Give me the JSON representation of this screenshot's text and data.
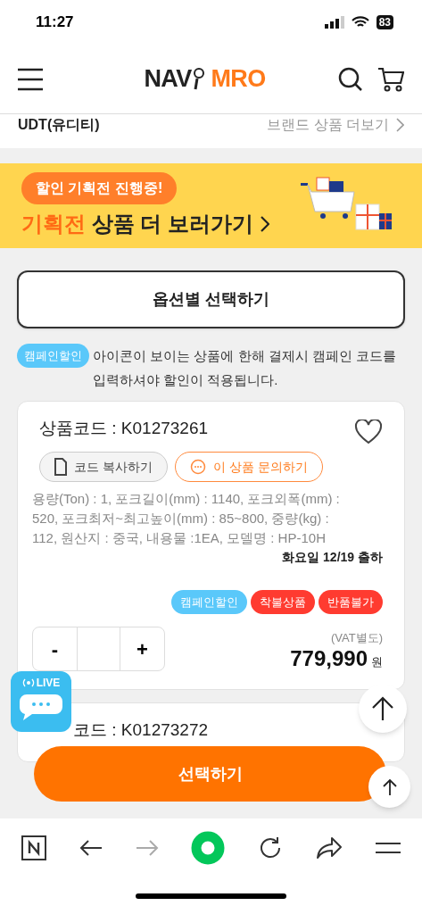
{
  "status_bar": {
    "time": "11:27",
    "battery": "83"
  },
  "header": {
    "logo_left": "NAV",
    "logo_right": "MRO"
  },
  "brand_bar": {
    "brand": "UDT(유디티)",
    "link": "브랜드 상품 더보기"
  },
  "banner": {
    "badge": "할인 기획전 진행중!",
    "highlight": "기획전",
    "title": "상품 더 보러가기"
  },
  "option_button": "옵션별 선택하기",
  "notice": {
    "tag": "캠페인할인",
    "text": "아이콘이 보이는 상품에 한해 결제시 캠페인 코드를 입력하셔야 할인이 적용됩니다."
  },
  "products": [
    {
      "code": "상품코드 : K01273261",
      "favorite": false,
      "copy_button": "코드 복사하기",
      "inquiry_button": "이 상품 문의하기",
      "specs": "용량(Ton) : 1, 포크길이(mm) : 1140, 포크외폭(mm) : 520, 포크최저~최고높이(mm) : 85~800, 중량(kg) : 112, 원산지 : 중국, 내용물 :1EA, 모델명 : HP-10H",
      "shipping": "화요일 12/19 출하",
      "tags": [
        {
          "label": "캠페인할인",
          "color": "#5ac8fa"
        },
        {
          "label": "착불상품",
          "color": "#ff3b30"
        },
        {
          "label": "반품불가",
          "color": "#ff3b30"
        }
      ],
      "minus": "-",
      "plus": "+",
      "vat": "(VAT별도)",
      "price": "779,990",
      "currency": "원"
    },
    {
      "code": "코드 : K01273272"
    }
  ],
  "live_chat": {
    "label": "LIVE"
  },
  "select_button": "선택하기"
}
